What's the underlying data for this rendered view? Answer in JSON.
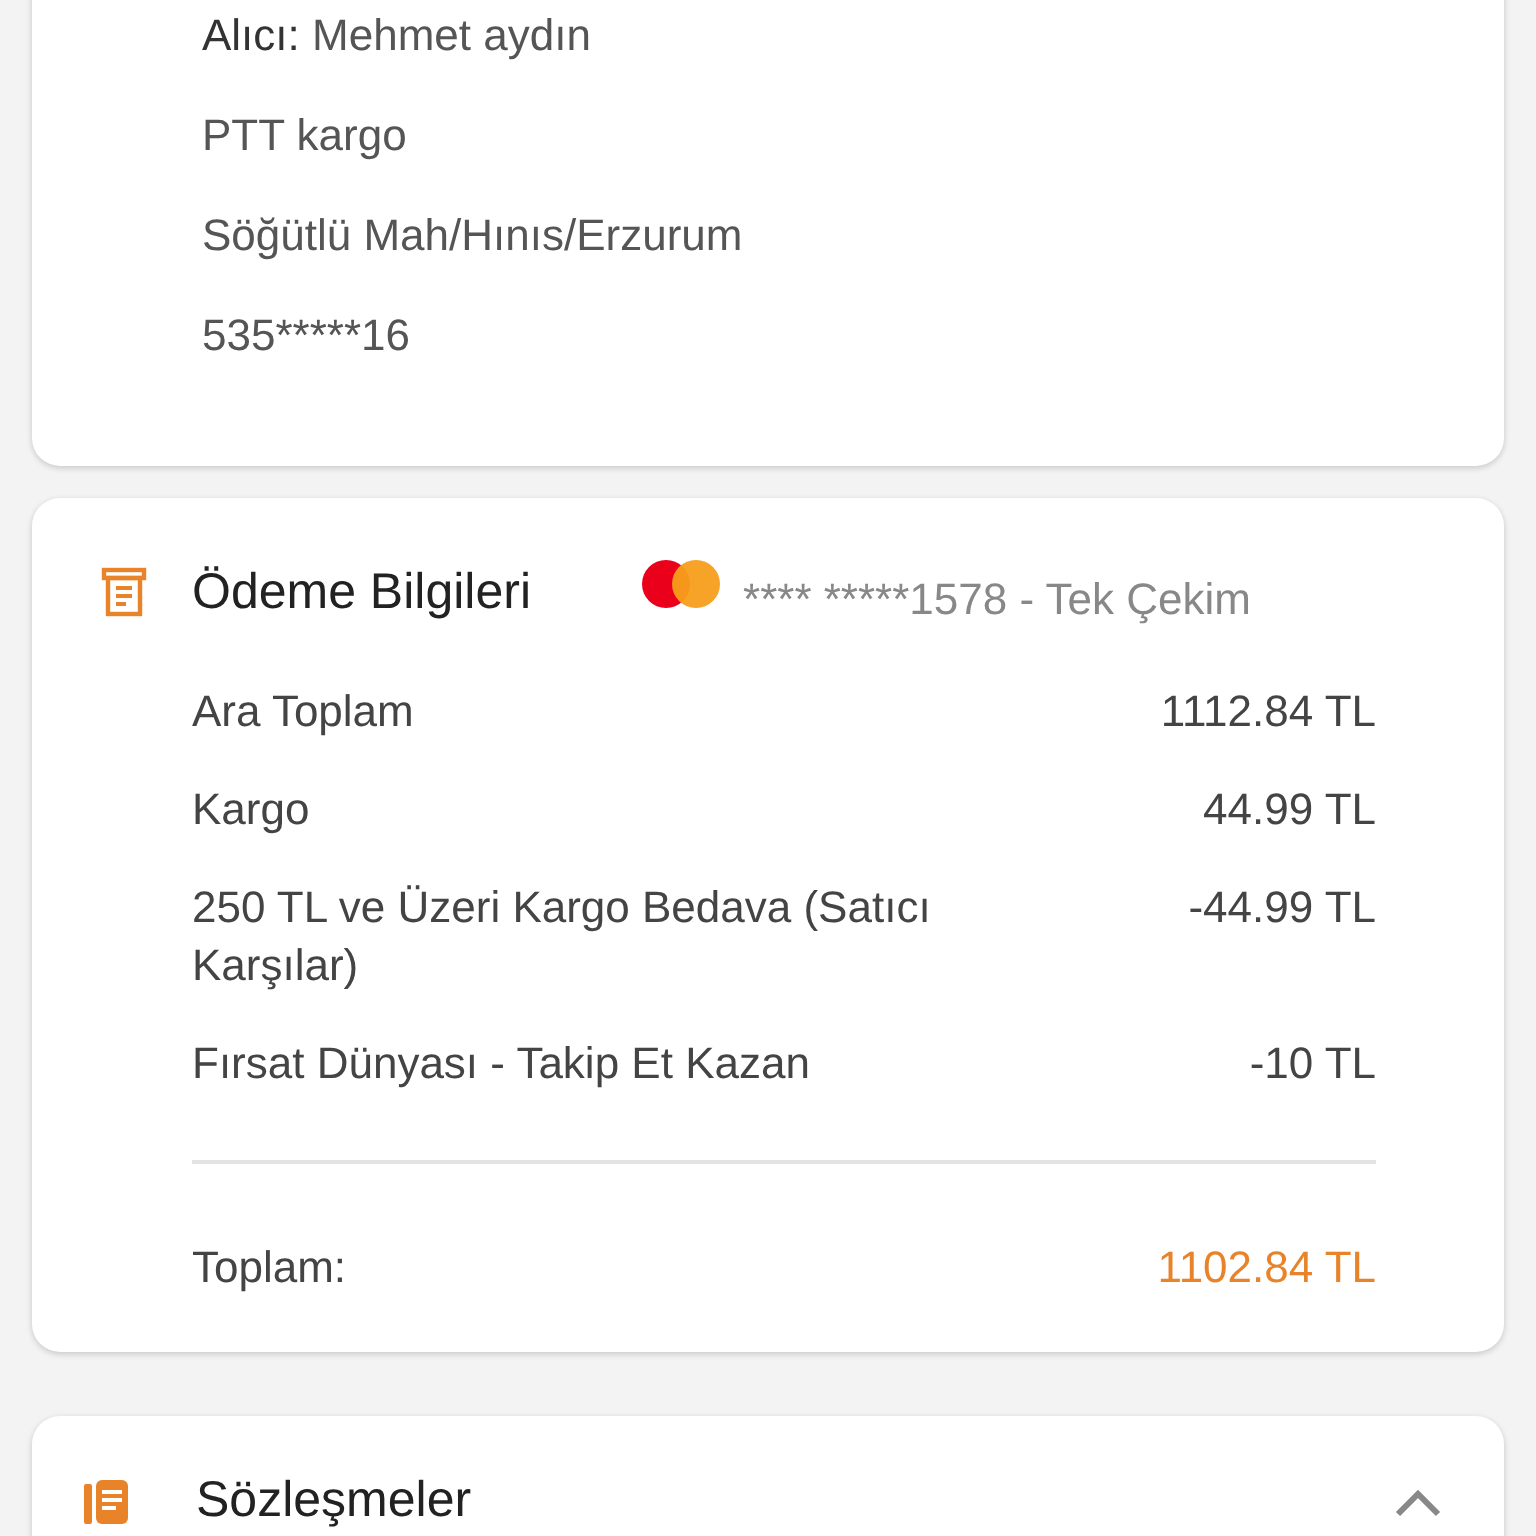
{
  "delivery": {
    "recipient_label": "Alıcı:",
    "recipient": "Mehmet aydın",
    "lines": [
      "PTT kargo",
      "Söğütlü Mah/Hınıs/Erzurum",
      "535*****16"
    ]
  },
  "payment": {
    "title": "Ödeme Bilgileri",
    "card": "**** *****1578 - Tek Çekim",
    "rows": [
      {
        "label": "Ara Toplam",
        "value": "1112.84 TL"
      },
      {
        "label": "Kargo",
        "value": "44.99 TL"
      },
      {
        "label": "250 TL ve Üzeri Kargo Bedava (Satıcı Karşılar)",
        "value": "-44.99 TL"
      },
      {
        "label": "Fırsat Dünyası - Takip Et Kazan",
        "value": "-10 TL"
      }
    ],
    "total_label": "Toplam:",
    "total_value": "1102.84 TL"
  },
  "contracts": {
    "title": "Sözleşmeler",
    "expanded": true
  }
}
